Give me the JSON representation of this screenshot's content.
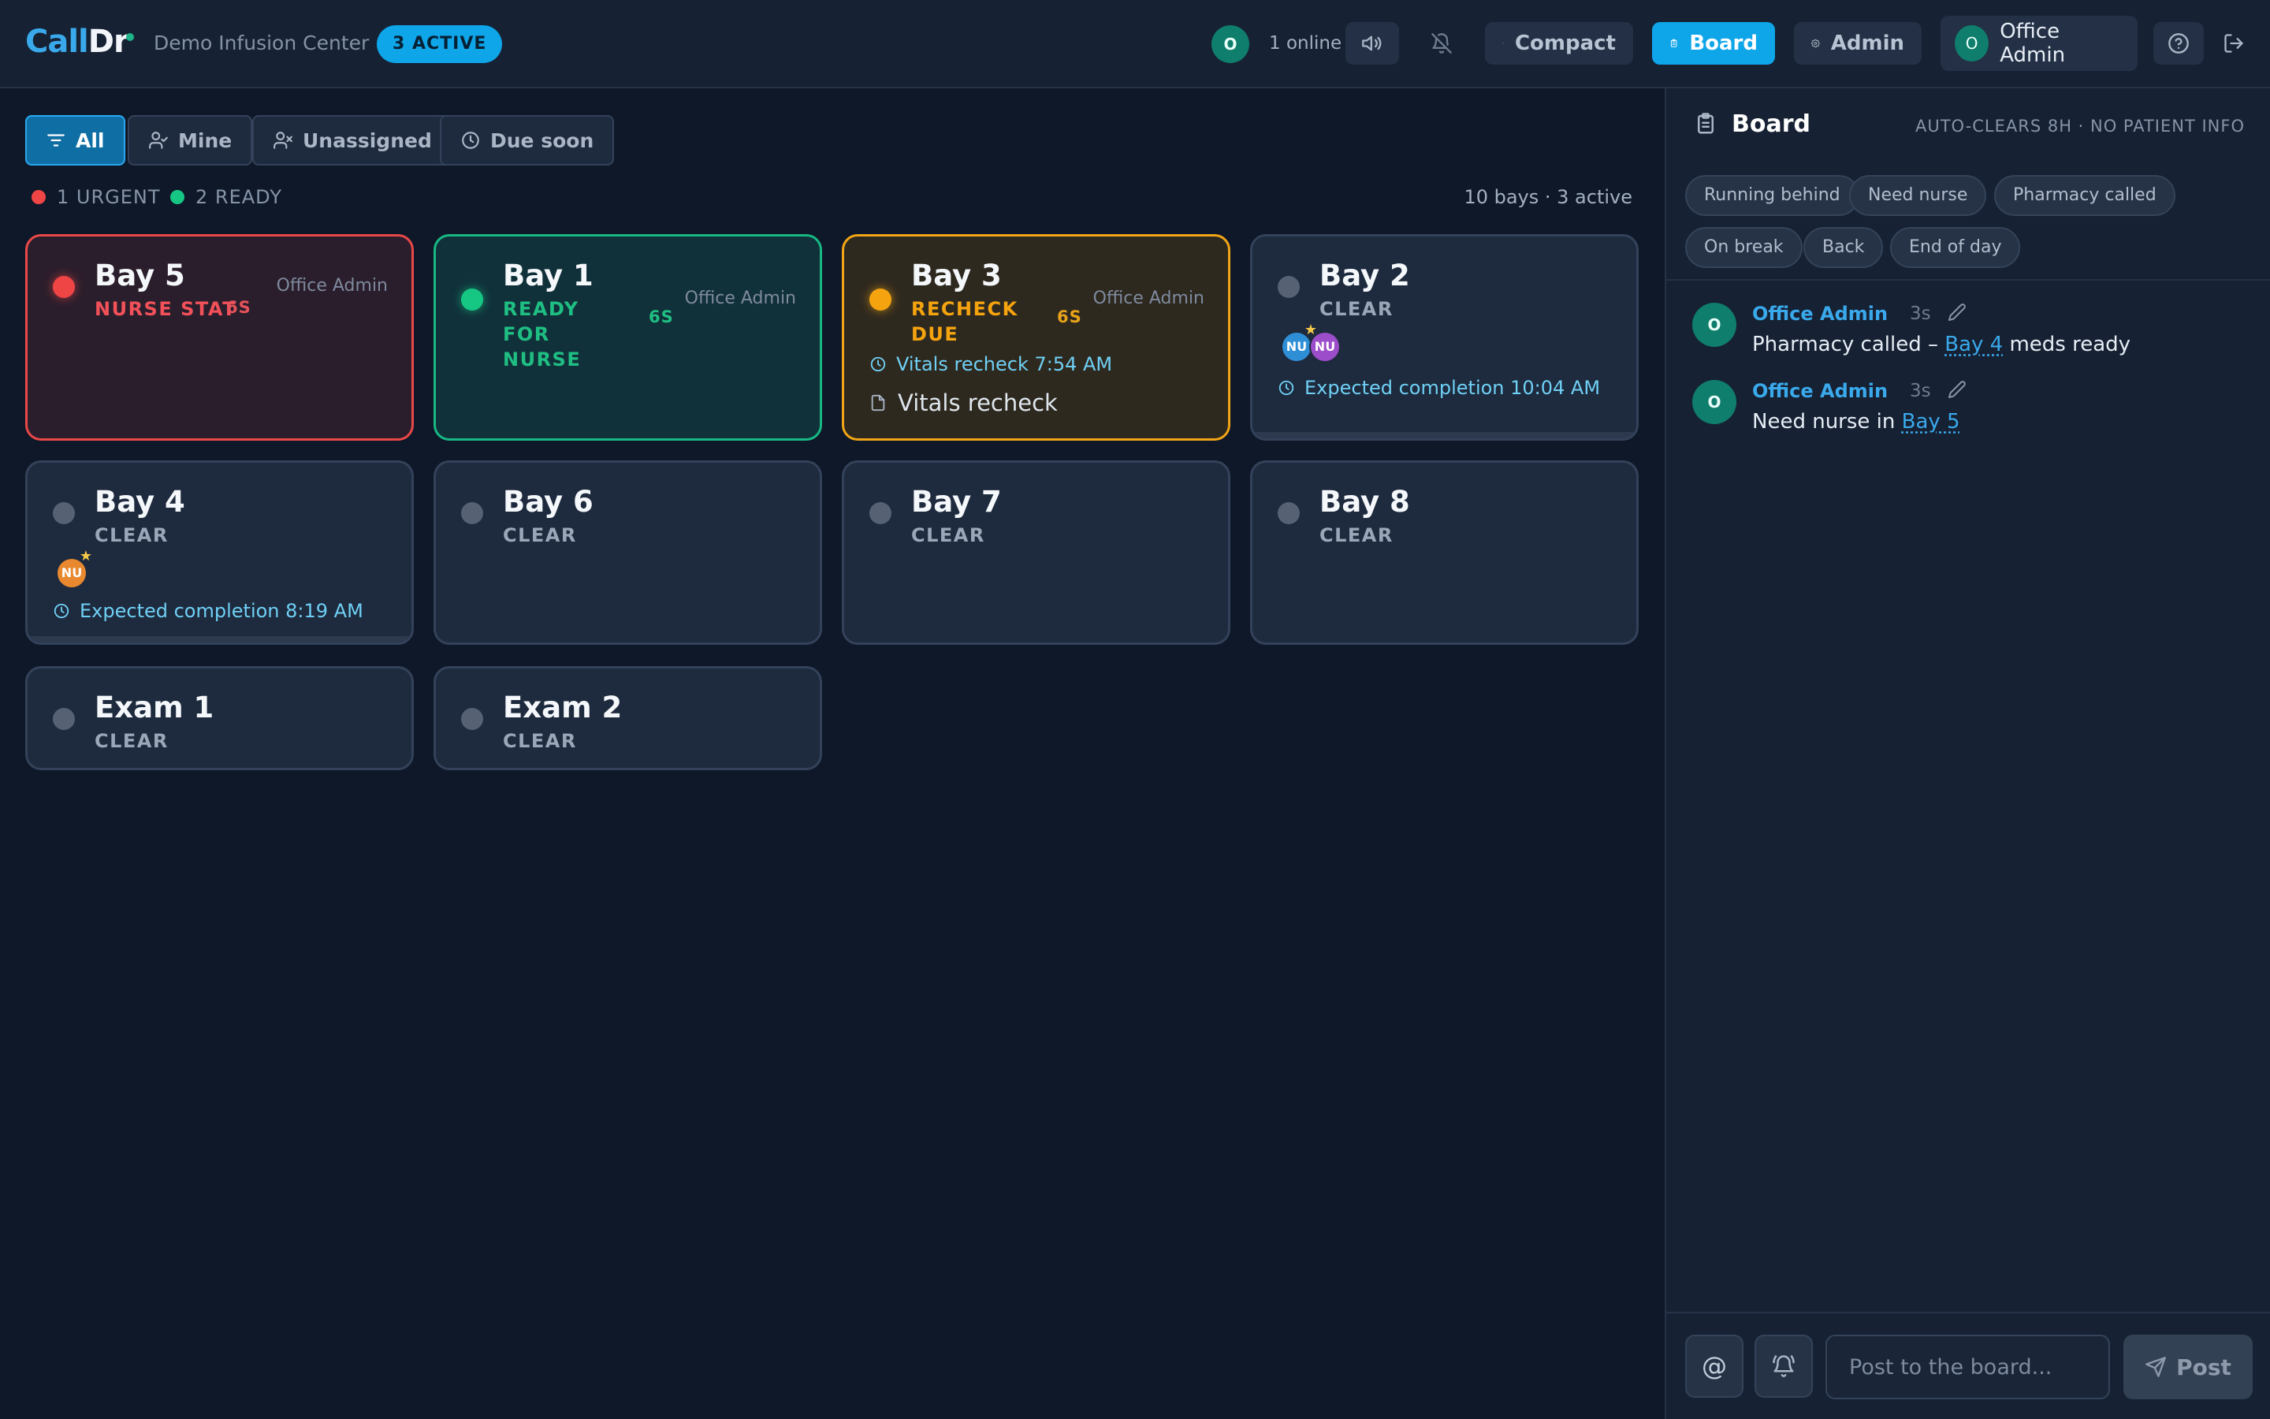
{
  "app": {
    "logo_part1": "Call",
    "logo_part2": "Dr",
    "center_name": "Demo Infusion Center",
    "active_badge": "3 ACTIVE"
  },
  "topbar": {
    "online_avatar": "O",
    "online_text": "1 online",
    "compact_label": "Compact",
    "board_label": "Board",
    "admin_label": "Admin",
    "user_avatar": "O",
    "user_name": "Office Admin"
  },
  "filters": {
    "all": "All",
    "mine": "Mine",
    "unassigned": "Unassigned",
    "due_soon": "Due soon"
  },
  "legend": {
    "urgent": "1 URGENT",
    "ready": "2 READY"
  },
  "summary": "10 bays · 3 active",
  "bays": [
    {
      "name": "Bay 5",
      "status": "NURSE STAT",
      "age": "6S",
      "owner": "Office Admin",
      "state": "urgent"
    },
    {
      "name": "Bay 1",
      "status": "READY FOR NURSE",
      "age": "6S",
      "owner": "Office Admin",
      "state": "ready"
    },
    {
      "name": "Bay 3",
      "status": "RECHECK DUE",
      "age": "6S",
      "owner": "Office Admin",
      "state": "due",
      "timer_label": "Vitals recheck 7:54 AM",
      "note": "Vitals recheck"
    },
    {
      "name": "Bay 2",
      "status": "CLEAR",
      "state": "clear",
      "staff": [
        {
          "initials": "NU",
          "color": "#2e8fd6",
          "lead": true
        },
        {
          "initials": "NU",
          "color": "#9b4dca",
          "lead": false
        }
      ],
      "expected": "Expected completion 10:04 AM"
    },
    {
      "name": "Bay 4",
      "status": "CLEAR",
      "state": "clear",
      "staff": [
        {
          "initials": "NU",
          "color": "#e8892f",
          "lead": true
        }
      ],
      "expected": "Expected completion 8:19 AM"
    },
    {
      "name": "Bay 6",
      "status": "CLEAR",
      "state": "clear"
    },
    {
      "name": "Bay 7",
      "status": "CLEAR",
      "state": "clear"
    },
    {
      "name": "Bay 8",
      "status": "CLEAR",
      "state": "clear"
    },
    {
      "name": "Exam 1",
      "status": "CLEAR",
      "state": "clear"
    },
    {
      "name": "Exam 2",
      "status": "CLEAR",
      "state": "clear"
    }
  ],
  "board": {
    "title": "Board",
    "subtitle": "AUTO-CLEARS 8H · NO PATIENT INFO",
    "quick_chips": [
      "Running behind",
      "Need nurse",
      "Pharmacy called",
      "On break",
      "Back",
      "End of day"
    ],
    "messages": [
      {
        "avatar": "O",
        "author": "Office Admin",
        "ago": "3s",
        "pre": "Pharmacy called – ",
        "link": "Bay 4",
        "post": " meds ready"
      },
      {
        "avatar": "O",
        "author": "Office Admin",
        "ago": "3s",
        "pre": "Need nurse in ",
        "link": "Bay 5",
        "post": ""
      }
    ],
    "composer": {
      "mention_symbol": "@",
      "placeholder": "Post to the board...",
      "post_label": "Post"
    }
  },
  "colors": {
    "accent": "#0ea5e9",
    "urgent": "#f04545",
    "ready": "#16c784",
    "due": "#f5a40f",
    "background": "#0e1828",
    "panel": "#162133"
  }
}
